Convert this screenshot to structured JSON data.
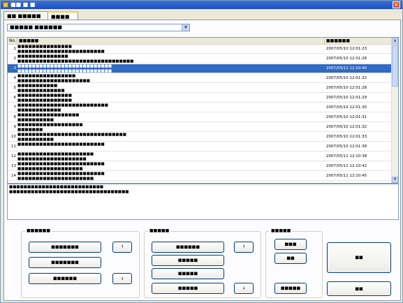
{
  "window": {
    "title": "■■ ■ ■"
  },
  "tabs": [
    {
      "label": "■■ ■■■■■"
    },
    {
      "label": "■■■■"
    }
  ],
  "group_selector": {
    "value": "■■■■■ ■■■■■■"
  },
  "list": {
    "columns": [
      {
        "label": "No."
      },
      {
        "label": "■■■■■"
      },
      {
        "label": "■■■■■■"
      }
    ],
    "rows": [
      {
        "num": "1",
        "line1": "■■■■■■■■■■■■■■■",
        "line2": "■■■■■■■■■■■■■■■■■■■■■■■■",
        "date": "2007/05/10 12:01:23"
      },
      {
        "num": "2",
        "line1": "■■■■■■■■■■■■■■",
        "line2": "■■■■■■■■■■■■■■■■■■■■■■■■■■■■■■■■",
        "date": "2007/05/10 12:01:28"
      },
      {
        "num": "3",
        "line1": "■■■■■■■■■■■■■■■■■■■■■■■■■■",
        "line2": "■■■■■■■■■■■■■■■■■■■■■■■■■■",
        "date": "2007/05/11 12:10:40"
      },
      {
        "num": "4",
        "line1": "■■■■■■■■■■■■■■■■",
        "line2": "■■■■■■■■■■■■■■■■■■■■",
        "date": "2007/05/10 12:01:22"
      },
      {
        "num": "5",
        "line1": "■■■■■■■■■■■",
        "line2": "■■■■■■■■■■■■■",
        "date": "2007/05/10 12:01:28"
      },
      {
        "num": "6",
        "line1": "■■■■■■■■■■■■■■■",
        "line2": "■■■■■■■■■■■■■■■",
        "date": "2007/05/10 12:01:29"
      },
      {
        "num": "7",
        "line1": "■■■■■■■■■■■■■■■■■■■■■■■■■",
        "line2": "■■■■■■■■■■■■",
        "date": "2007/05/10 12:01:30"
      },
      {
        "num": "8",
        "line1": "■■■■■■■■■■■■■■■■■",
        "line2": "■■■■■■■■■■",
        "date": "2007/05/10 12:01:31"
      },
      {
        "num": "9",
        "line1": "■■■■■■■■■■■■■■■■■■",
        "line2": "■■■■■■■",
        "date": "2007/05/10 12:01:32"
      },
      {
        "num": "10",
        "line1": "■■■■■■■■■■■■■■■■■■■■■■■■■■■■■■",
        "line2": "■■■■■■■■■■",
        "date": "2007/05/10 12:01:33"
      },
      {
        "num": "11",
        "line1": "■■■■■■■■■■■■■■■■■■■■■■■■",
        "line2": "",
        "date": "2007/05/10 12:01:38"
      },
      {
        "num": "12",
        "line1": "■■■■■■■■■■■■■■■■■■■■■",
        "line2": "■■■■■■■■■■■■■■■■■■■",
        "date": "2007/05/11 12:10:38"
      },
      {
        "num": "13",
        "line1": "■■■■■■■■■■■■■■■■■■■■■■■■",
        "line2": "■■■■■■■■■■■■■■■■■■",
        "date": "2007/05/11 12:10:42"
      },
      {
        "num": "14",
        "line1": "■■■■■■■■■■■■■■■■■■■■■■■■",
        "line2": "■■■■■■■■■■■■■■■■■■■■■",
        "date": "2007/05/11 12:10:45"
      }
    ]
  },
  "preview": {
    "line1": "■■■■■■■■■■■■■■■■■■■■■■■■■■",
    "line2": "■■■■■■■■■■■■■■■■■■■■■■■■■■■■■■■■■"
  },
  "group_manage": {
    "legend": "■■■■■■",
    "add": "■■■■■■■",
    "edit": "■■■■■■■",
    "delete": "■■■■■■",
    "up": "↑",
    "down": "↓"
  },
  "text_manage": {
    "legend": "■■■■■",
    "insert": "■■■■■■",
    "add": "■■■■■",
    "edit": "■■■■■",
    "delete": "■■■■■",
    "up": "↑",
    "down": "↓"
  },
  "text_ops": {
    "legend": "■■■■■",
    "copy": "■■■",
    "paste": "■■",
    "read": "■■■■■"
  },
  "actions": {
    "save": "■■",
    "close": "■■"
  }
}
